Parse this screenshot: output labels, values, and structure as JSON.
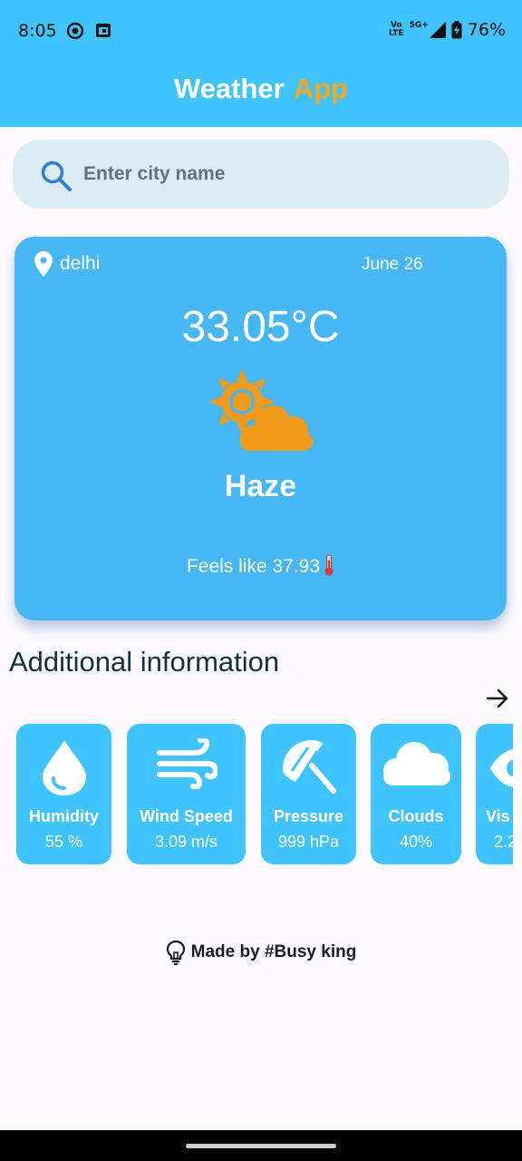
{
  "status_bar": {
    "time": "8:05",
    "network_top": "Vo",
    "network_bottom": "LTE",
    "signal_type": "5G+",
    "battery": "76%",
    "icons": [
      "circle-app-icon",
      "calendar-app-icon",
      "signal-icon",
      "battery-icon"
    ]
  },
  "header": {
    "title_part1": "Weather",
    "title_part2": "App"
  },
  "search": {
    "placeholder": "Enter city name",
    "value": ""
  },
  "current": {
    "city": "delhi",
    "date": "June 26",
    "temperature": "33.05°C",
    "condition": "Haze",
    "feels_like": "Feels like 37.93",
    "icons": [
      "location-pin-icon",
      "sun-cloud-icon",
      "thermometer-icon"
    ]
  },
  "additional": {
    "title": "Additional information",
    "items": [
      {
        "label": "Humidity",
        "value": "55 %",
        "icon": "water-drop-icon"
      },
      {
        "label": "Wind Speed",
        "value": "3.09 m/s",
        "icon": "wind-icon"
      },
      {
        "label": "Pressure",
        "value": "999 hPa",
        "icon": "umbrella-icon"
      },
      {
        "label": "Clouds",
        "value": "40%",
        "icon": "cloud-icon"
      },
      {
        "label": "Vis",
        "value": "2.2",
        "icon": "eye-icon"
      }
    ]
  },
  "footer": {
    "text": "Made by #Busy king"
  },
  "colors": {
    "app_bar": "#40c4ff",
    "card": "#46b6f5",
    "accent_orange": "#f5a623",
    "search_bg": "#dcecf5"
  }
}
